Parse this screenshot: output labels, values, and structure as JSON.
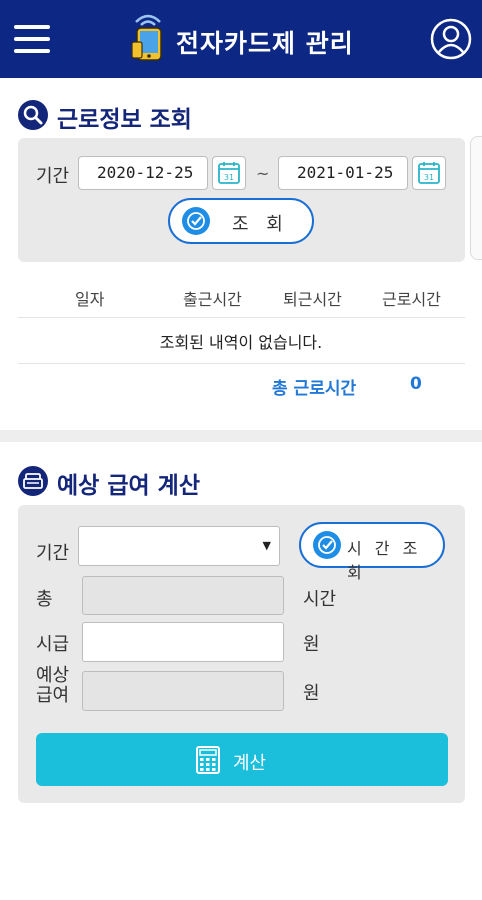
{
  "app": {
    "title": "전자카드제 관리"
  },
  "icons": {
    "menu": "hamburger-menu-icon",
    "logo": "phone-card-logo-icon",
    "profile": "user-profile-icon",
    "search": "search-icon",
    "calendar": "calendar-31-icon",
    "check": "check-circle-icon",
    "wallet": "wallet-icon",
    "calculator": "calculator-icon"
  },
  "work_info": {
    "title": "근로정보 조회",
    "period_label": "기간",
    "start_date": "2020-12-25",
    "end_date": "2021-01-25",
    "range_separator": "~",
    "calendar_text": "31",
    "search_button": "조 회",
    "columns": [
      "일자",
      "출근시간",
      "퇴근시간",
      "근로시간"
    ],
    "empty_message": "조회된 내역이 없습니다.",
    "total_label": "총 근로시간",
    "total_value": "0"
  },
  "salary": {
    "title": "예상 급여 계산",
    "period_label": "기간",
    "period_value": "",
    "period_caret": "▼",
    "time_search_button": "시 간 조 회",
    "total_label": "총",
    "total_value": "",
    "total_unit": "시간",
    "wage_label": "시급",
    "wage_value": "",
    "wage_unit": "원",
    "expected_label_line1": "예상",
    "expected_label_line2": "급여",
    "expected_value": "",
    "expected_unit": "원",
    "calc_button": "계산"
  },
  "colors": {
    "header_bg": "#0d2784",
    "section_title": "#14267a",
    "accent_blue": "#2278d6",
    "calc_button_bg": "#1bbfdc",
    "calendar_teal": "#29b5c9",
    "card_bg": "#e9e9e9"
  }
}
